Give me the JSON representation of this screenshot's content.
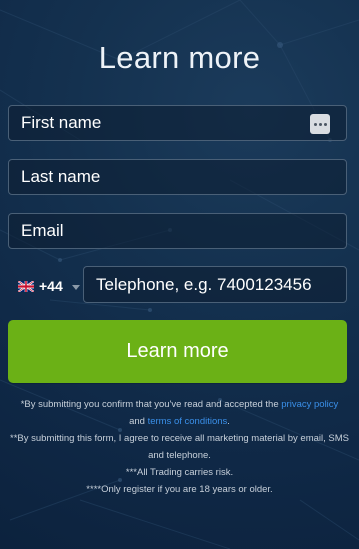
{
  "title": "Learn more",
  "form": {
    "first_name_placeholder": "First name",
    "last_name_placeholder": "Last name",
    "email_placeholder": "Email",
    "country_code": "+44",
    "telephone_placeholder": "Telephone, e.g. 7400123456",
    "submit_label": "Learn more"
  },
  "disclaimer": {
    "line1_pre": "*By submitting you confirm that you've read and accepted the ",
    "privacy_link": "privacy policy",
    "line2_pre": "and ",
    "terms_link": "terms of conditions",
    "line2_post": ".",
    "marketing": "**By submitting this form, I agree to receive all marketing material by email, SMS and telephone.",
    "risk": "***All Trading carries risk.",
    "age": "****Only register if you are 18 years or older."
  },
  "icons": {
    "autofill": "contact-card-icon",
    "flag": "uk-flag-icon",
    "caret": "chevron-down-icon"
  },
  "colors": {
    "background": "#14314f",
    "button": "#6bb116",
    "link": "#3a8fe8",
    "field_border": "#4a6077"
  }
}
